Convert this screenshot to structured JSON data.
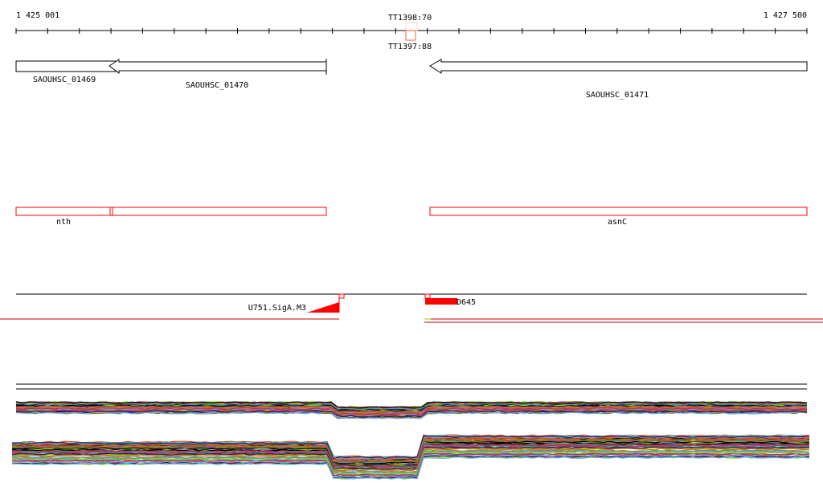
{
  "ruler": {
    "start_label": "1 425 001",
    "end_label": "1 427 500",
    "start": 1425001,
    "end": 1427500
  },
  "terminators": [
    {
      "label": "TT1398:70"
    },
    {
      "label": "TT1397:88"
    }
  ],
  "genes": [
    {
      "label": "SAOUHSC_01469",
      "strand": "-"
    },
    {
      "label": "SAOUHSC_01470",
      "strand": "-"
    },
    {
      "label": "SAOUHSC_01471",
      "strand": "-"
    }
  ],
  "gene_names": [
    {
      "label": "nth"
    },
    {
      "label": "asnC"
    }
  ],
  "features": [
    {
      "label": "U751.SigA.M3"
    },
    {
      "label": "D645"
    }
  ],
  "colors": {
    "feature": "#ff0000",
    "terminator": "#f06040",
    "gene_outline": "#000000"
  },
  "coverage_palette": [
    "#000000",
    "#8b7a1a",
    "#e05030",
    "#6ab0e8",
    "#7ee000",
    "#c03080",
    "#9090d0",
    "#d07020",
    "#202060",
    "#a04040",
    "#40a0a0"
  ]
}
